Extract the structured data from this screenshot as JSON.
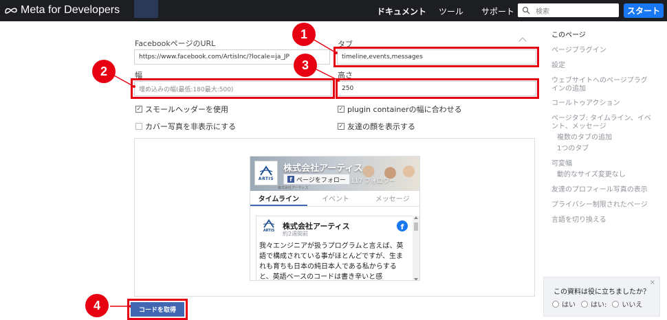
{
  "topbar": {
    "logo_text": "Meta for Developers",
    "nav_docs": "ドキュメント",
    "nav_tools": "ツール",
    "nav_support": "サポート",
    "search_placeholder": "検索",
    "start_button": "スタート"
  },
  "form": {
    "url_label": "FacebookページのURL",
    "url_value": "https://www.facebook.com/ArtisInc/?locale=ja_JP",
    "tabs_label": "タブ",
    "tabs_value": "timeline,events,messages",
    "width_label": "幅",
    "width_placeholder": "埋め込みの幅(最低:180最大:500)",
    "height_label": "高さ",
    "height_value": "250",
    "checks": [
      {
        "label": "スモールヘッダーを使用",
        "checked": true
      },
      {
        "label": "plugin containerの幅に合わせる",
        "checked": true
      },
      {
        "label": "カバー写真を非表示にする",
        "checked": false
      },
      {
        "label": "友達の顔を表示する",
        "checked": true
      }
    ],
    "get_code_button": "コードを取得"
  },
  "callouts": [
    "1",
    "2",
    "3",
    "4"
  ],
  "plugin": {
    "page_name": "株式会社アーティス",
    "follow_button": "ページをフォロー",
    "followers": "117 フォロワー",
    "logo_text": "ARTIS",
    "caption": "株式会社アーティス",
    "tabs": [
      "タイムライン",
      "イベント",
      "メッセージ"
    ],
    "post": {
      "name": "株式会社アーティス",
      "time": "約2週間前",
      "body": "我々エンジニアが扱うプログラムと言えば、英語で構成されている事がほとんどですが、生まれも育ちも日本の純日本人である私からすると、英語ベースのコードは書き辛いと感"
    }
  },
  "sidebar": {
    "items": [
      "このページ",
      "ページプラグイン",
      "設定",
      "ウェブサイトへのページプラグ",
      "インの追加",
      "コールトゥアクション",
      "ページタブ: タイムライン、イベ",
      "ント、メッセージ",
      "複数のタブの追加",
      "1つのタブ",
      "可変幅",
      "動的なサイズ変更なし",
      "友達のプロフィール写真の表示",
      "プライバシー制限されたページ",
      "言語を切り換える"
    ]
  },
  "feedback": {
    "question": "この資料は役に立ちましたか？",
    "close": "×",
    "options": [
      "はい",
      "はい:",
      "いいえ"
    ]
  },
  "colors": {
    "highlight": "#e60012",
    "accent": "#1877f2",
    "fb_blue": "#4267b2"
  }
}
